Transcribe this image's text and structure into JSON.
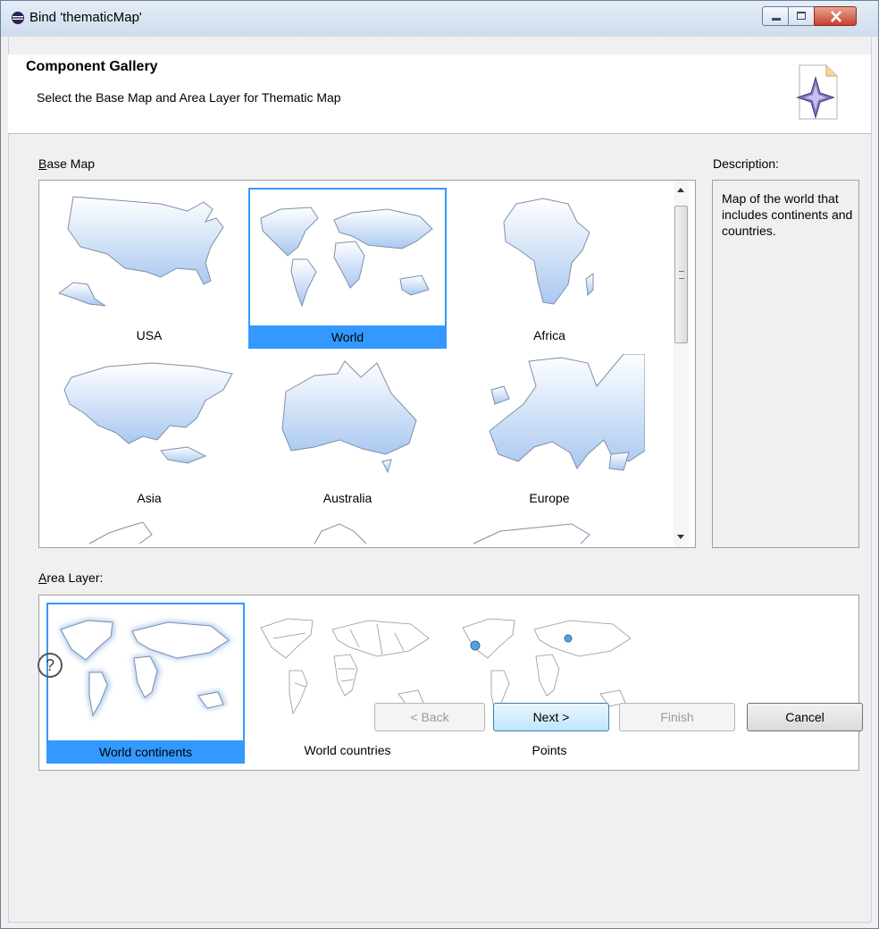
{
  "window": {
    "title": "Bind 'thematicMap'",
    "controls": [
      "minimize",
      "maximize",
      "close"
    ]
  },
  "header": {
    "title": "Component Gallery",
    "subtitle": "Select the Base Map and Area Layer for Thematic Map",
    "icon": "wizard-star-icon"
  },
  "base_map": {
    "label": "Base Map",
    "mnemonic": "B",
    "items": [
      {
        "caption": "USA",
        "selected": false
      },
      {
        "caption": "World",
        "selected": true
      },
      {
        "caption": "Africa",
        "selected": false
      },
      {
        "caption": "Asia",
        "selected": false
      },
      {
        "caption": "Australia",
        "selected": false
      },
      {
        "caption": "Europe",
        "selected": false
      }
    ]
  },
  "description": {
    "label": "Description:",
    "text": "Map of the world that includes continents and countries."
  },
  "area_layer": {
    "label": "Area Layer:",
    "mnemonic": "A",
    "items": [
      {
        "caption": "World continents",
        "selected": true
      },
      {
        "caption": "World countries",
        "selected": false
      },
      {
        "caption": "Points",
        "selected": false
      }
    ]
  },
  "footer": {
    "help": "?",
    "back": "< Back",
    "next": "Next >",
    "finish": "Finish",
    "cancel": "Cancel"
  },
  "colors": {
    "selection": "#3399ff",
    "map_fill_top": "#ffffff",
    "map_fill_bottom": "#a9c8f0"
  }
}
